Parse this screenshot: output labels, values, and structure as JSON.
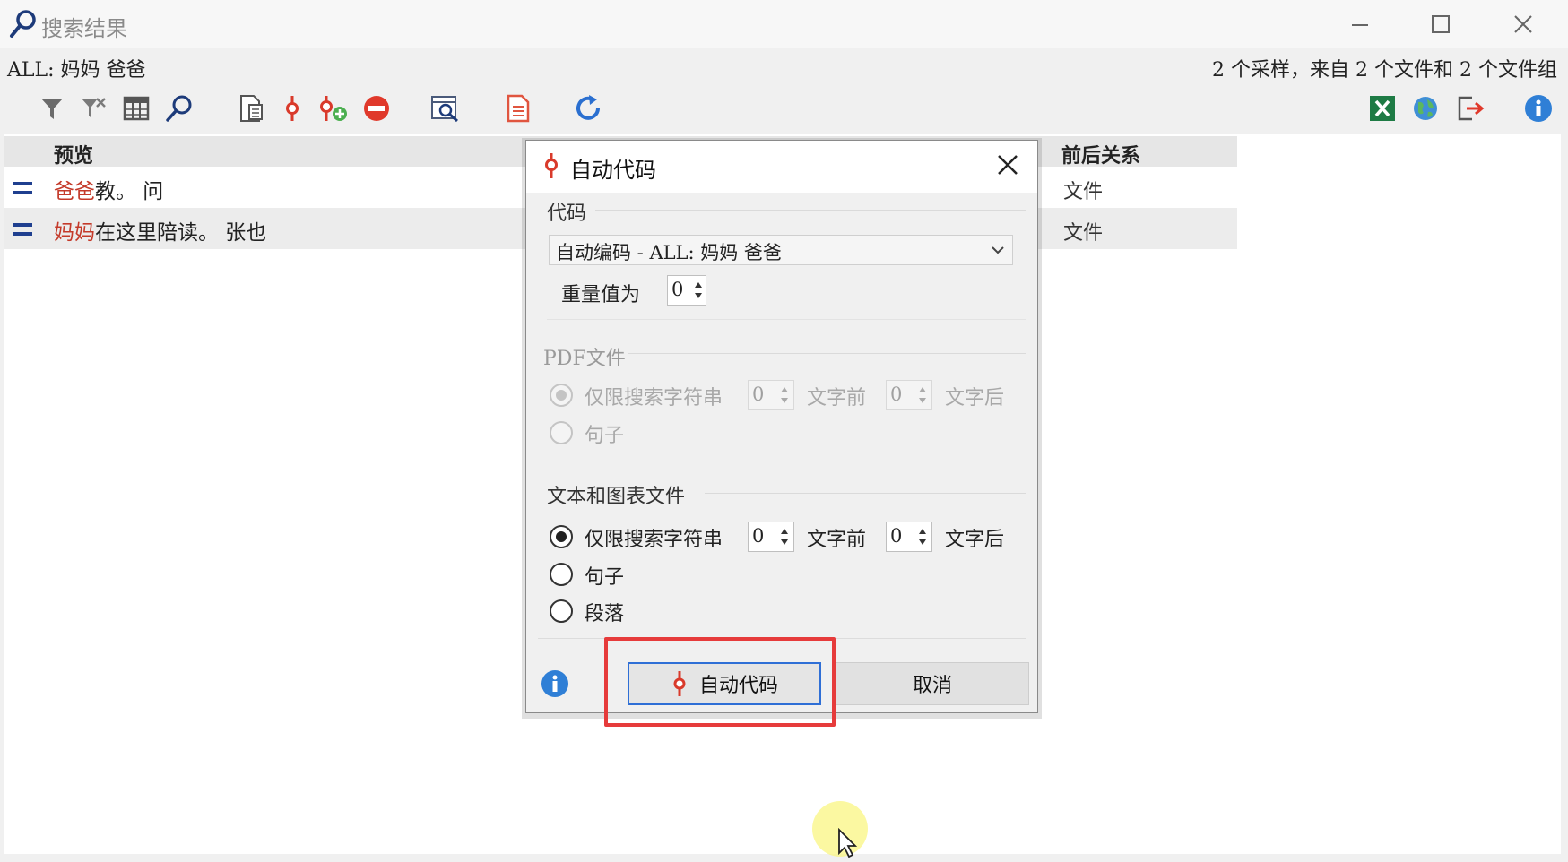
{
  "window": {
    "title": "搜索结果",
    "icons": {
      "title": "magnifier-icon",
      "minimize": "minimize-icon",
      "maximize": "maximize-icon",
      "close": "close-icon"
    }
  },
  "infobar": {
    "query": "ALL: 妈妈 爸爸",
    "summary": "2 个采样，来自 2 个文件和 2 个文件组"
  },
  "toolbar": {
    "left_icons": [
      "filter-icon",
      "clear-filter-icon",
      "columns-icon",
      "search-icon",
      "document-preview-icon",
      "code-icon",
      "add-code-icon",
      "remove-icon",
      "find-in-doc-icon",
      "report-icon",
      "refresh-icon"
    ],
    "right_icons": [
      "excel-export-icon",
      "globe-icon",
      "export-icon",
      "info-icon"
    ]
  },
  "grid": {
    "columns": {
      "preview": "预览",
      "context": "前后关系"
    },
    "rows": [
      {
        "highlight": "爸爸",
        "rest": "教。 问",
        "context": "文件"
      },
      {
        "highlight": "妈妈",
        "rest": "在这里陪读。 张也",
        "context": "文件"
      }
    ]
  },
  "dialog": {
    "title": "自动代码",
    "code_section": "代码",
    "code_selected": "自动编码 - ALL: 妈妈 爸爸",
    "weight_label": "重量值为",
    "weight_value": "0",
    "pdf_section": "PDF文件",
    "pdf_options": {
      "search_string": "仅限搜索字符串",
      "before_value": "0",
      "before_label": "文字前",
      "after_value": "0",
      "after_label": "文字后",
      "sentence": "句子"
    },
    "text_section": "文本和图表文件",
    "text_options": {
      "search_string": "仅限搜索字符串",
      "before_value": "0",
      "before_label": "文字前",
      "after_value": "0",
      "after_label": "文字后",
      "sentence": "句子",
      "paragraph": "段落"
    },
    "autocode_button": "自动代码",
    "cancel_button": "取消"
  },
  "colors": {
    "highlight": "#c43a2a",
    "focus_ring": "#e63b3b",
    "button_border": "#2f6fd6",
    "code_icon": "#d93a2b"
  }
}
